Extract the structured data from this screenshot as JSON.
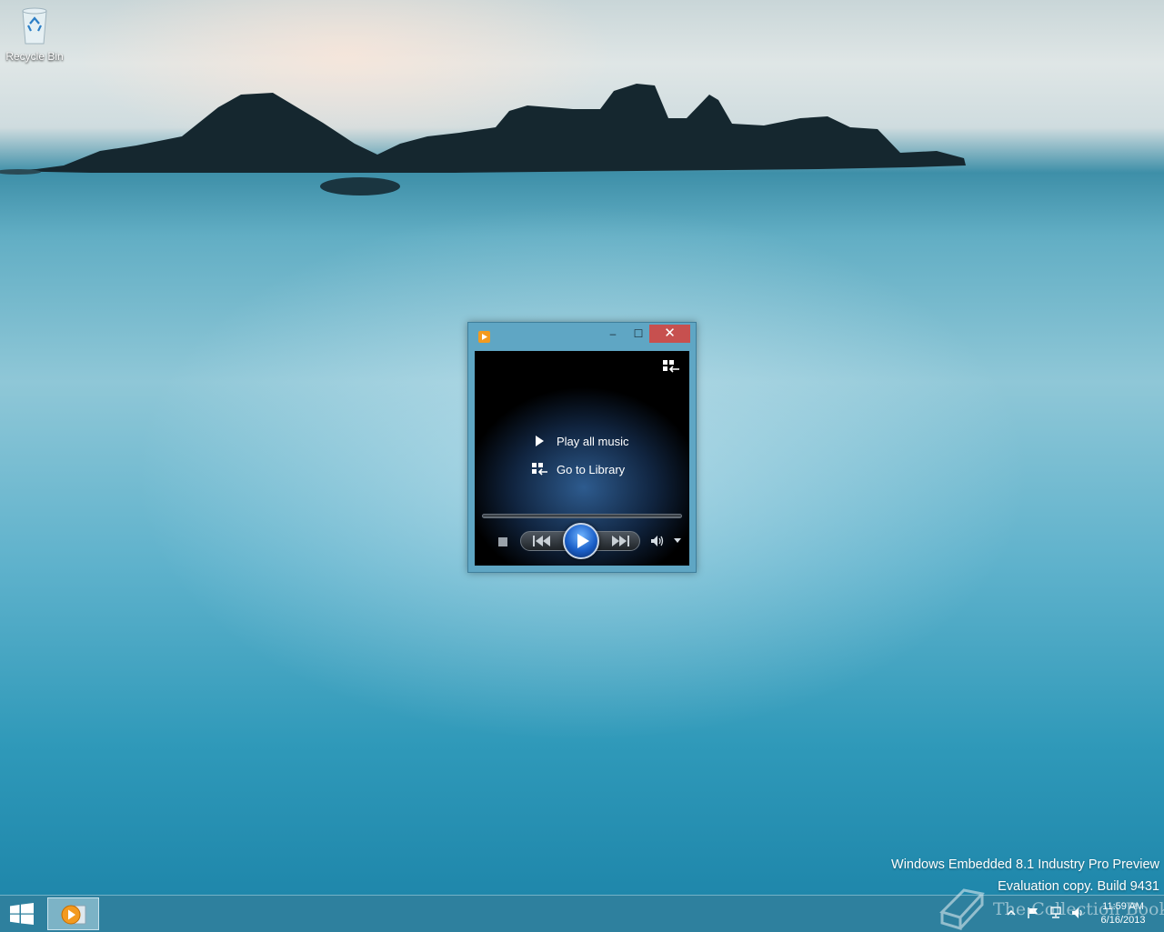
{
  "desktop": {
    "icons": [
      {
        "label": "Recycle Bin",
        "icon": "recycle-bin-icon"
      }
    ]
  },
  "media_player": {
    "app_icon": "windows-media-player-icon",
    "title_buttons": {
      "minimize": "–",
      "maximize": "☐",
      "close": "✕"
    },
    "menu": {
      "play_all": "Play all music",
      "go_to_library": "Go to Library"
    },
    "controls": {
      "stop": "stop-icon",
      "previous": "previous-track-icon",
      "play": "play-icon",
      "next": "next-track-icon",
      "volume": "volume-icon",
      "volume_menu": "chevron-down-icon"
    }
  },
  "watermark": {
    "line1": "Windows Embedded 8.1 Industry Pro Preview",
    "line2": "Evaluation copy. Build 9431"
  },
  "taskbar": {
    "start_icon": "windows-logo-icon",
    "pinned_apps": [
      "windows-media-player-icon"
    ],
    "tray_icons": [
      "chevron-up-icon",
      "flag-icon",
      "network-icon",
      "speaker-icon"
    ],
    "clock": {
      "time": "11:59 AM",
      "date": "6/16/2013"
    }
  },
  "site_watermark": {
    "text": "The Collection Book"
  }
}
